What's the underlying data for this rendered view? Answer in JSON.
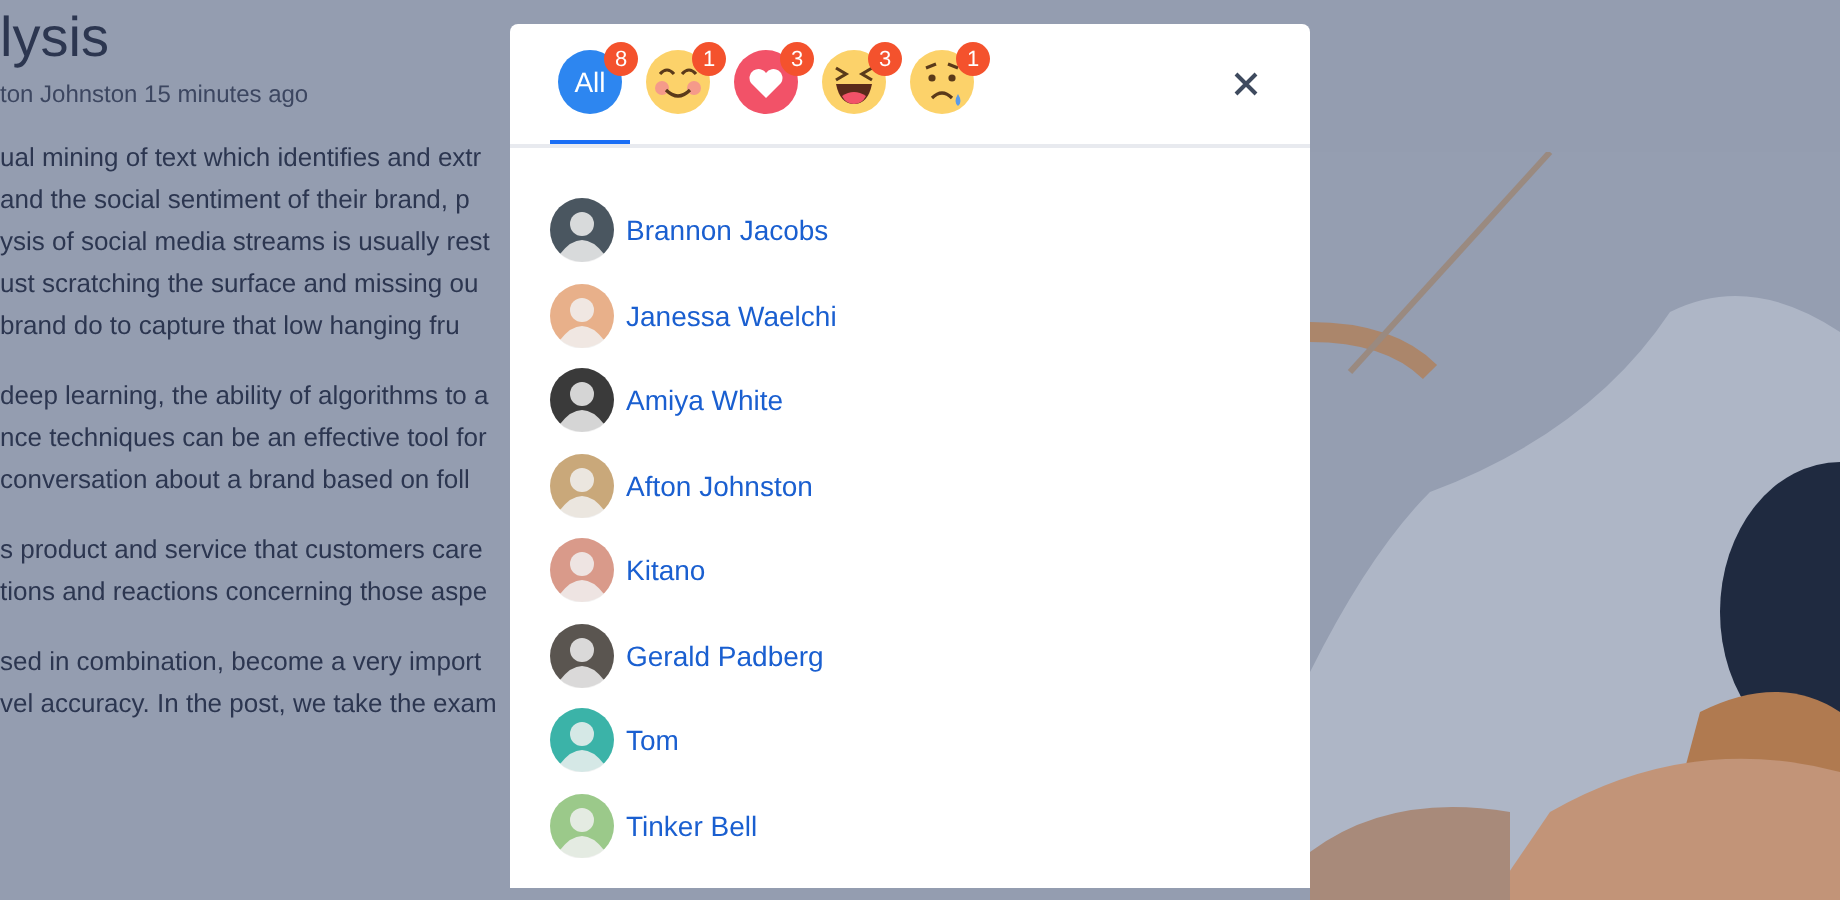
{
  "article": {
    "title": "lysis",
    "meta": "ton Johnston 15 minutes ago",
    "paragraphs": [
      [
        "ual mining of text which identifies and extr",
        "and the social sentiment of their brand, p",
        "ysis of social media streams is usually rest",
        "ust scratching the surface and missing ou",
        "brand do to capture that low hanging fru"
      ],
      [
        "deep learning, the ability of algorithms to a",
        "nce techniques can be an effective tool for",
        "conversation about a brand based on foll"
      ],
      [
        "s product and service that customers care",
        "tions and reactions concerning those aspe"
      ],
      [
        "sed in combination, become a very import",
        "vel accuracy. In the post, we take the exam"
      ]
    ]
  },
  "modal": {
    "tabs": [
      {
        "kind": "all",
        "label": "All",
        "count": "8",
        "selected": true
      },
      {
        "kind": "blush",
        "count": "1",
        "selected": false
      },
      {
        "kind": "heart",
        "count": "3",
        "selected": false
      },
      {
        "kind": "laugh",
        "count": "3",
        "selected": false
      },
      {
        "kind": "sad",
        "count": "1",
        "selected": false
      }
    ],
    "people": [
      "Brannon Jacobs",
      "Janessa Waelchi",
      "Amiya White",
      "Afton Johnston",
      "Kitano",
      "Gerald Padberg",
      "Tom",
      "Tinker Bell"
    ]
  }
}
